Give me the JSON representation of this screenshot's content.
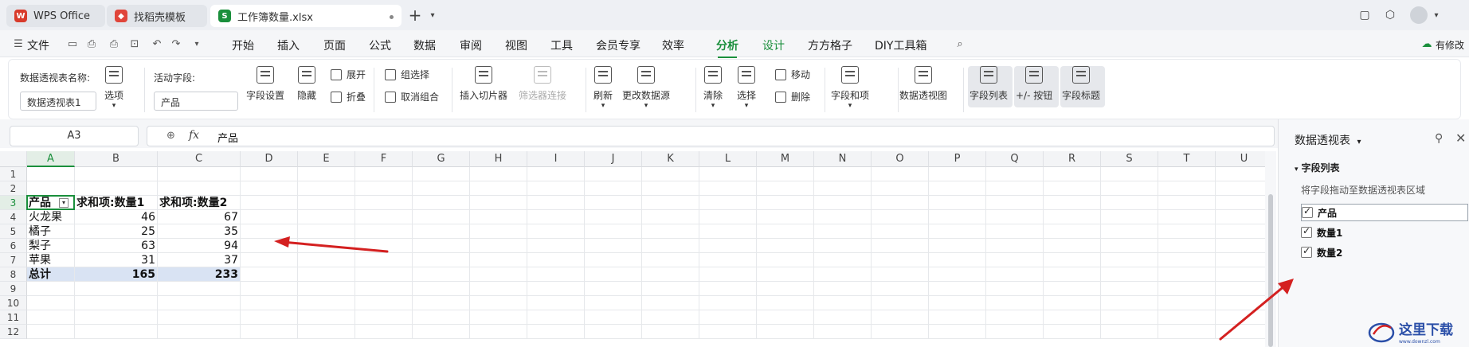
{
  "titlebar": {
    "app_tab": "WPS Office",
    "tab2": "找稻壳模板",
    "tab3": "工作簿数量.xlsx",
    "new_tab": "+"
  },
  "menubar": {
    "file": "文件",
    "items": [
      "开始",
      "插入",
      "页面",
      "公式",
      "数据",
      "审阅",
      "视图",
      "工具",
      "会员专享",
      "效率",
      "分析",
      "设计",
      "方方格子",
      "DIY工具箱"
    ],
    "active": "分析",
    "right": "有修改"
  },
  "ribbon": {
    "pt_name_label": "数据透视表名称:",
    "pt_name_value": "数据透视表1",
    "options": "选项",
    "active_field_label": "活动字段:",
    "active_field_value": "产品",
    "field_settings": "字段设置",
    "hide": "隐藏",
    "expand": "展开",
    "collapse": "折叠",
    "group_select": "组选择",
    "ungroup": "取消组合",
    "insert_slicer": "插入切片器",
    "filter_conn": "筛选器连接",
    "refresh": "刷新",
    "change_source": "更改数据源",
    "clear": "清除",
    "select": "选择",
    "move": "移动",
    "delete": "删除",
    "fields_items": "字段和项",
    "pivot_chart": "数据透视图",
    "field_list": "字段列表",
    "pm_buttons": "+/- 按钮",
    "field_headers": "字段标题"
  },
  "formulabar": {
    "cell_ref": "A3",
    "fx": "fx",
    "content": "产品"
  },
  "grid": {
    "columns": [
      "A",
      "B",
      "C",
      "D",
      "E",
      "F",
      "G",
      "H",
      "I",
      "J",
      "K",
      "L",
      "M",
      "N",
      "O",
      "P",
      "Q",
      "R",
      "S",
      "T",
      "U"
    ],
    "rows": [
      "1",
      "2",
      "3",
      "4",
      "5",
      "6",
      "7",
      "8",
      "9",
      "10",
      "11",
      "12"
    ],
    "header": [
      "产品",
      "求和项:数量1",
      "求和项:数量2"
    ],
    "data": [
      [
        "火龙果",
        "46",
        "67"
      ],
      [
        "橘子",
        "25",
        "35"
      ],
      [
        "梨子",
        "63",
        "94"
      ],
      [
        "苹果",
        "31",
        "37"
      ]
    ],
    "total": [
      "总计",
      "165",
      "233"
    ]
  },
  "panel": {
    "title": "数据透视表",
    "section": "字段列表",
    "hint": "将字段拖动至数据透视表区域",
    "fields": [
      "产品",
      "数量1",
      "数量2"
    ]
  },
  "colors": {
    "accent": "#1a8f3c",
    "arrow": "#d42020",
    "total_bg": "#d9e3f3"
  }
}
